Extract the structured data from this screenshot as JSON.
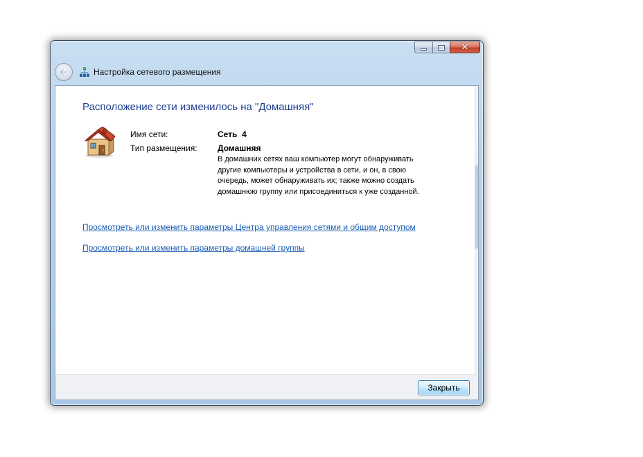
{
  "window": {
    "title": "Настройка сетевого размещения"
  },
  "caption": {
    "minimize_icon": "minimize-icon",
    "maximize_icon": "maximize-icon",
    "close_icon": "close-icon"
  },
  "main": {
    "heading": "Расположение сети изменилось на \"Домашняя\"",
    "network_name_label": "Имя сети:",
    "network_name_value": "Сеть  4",
    "location_type_label": "Тип размещения:",
    "location_type_value": "Домашняя",
    "description": "В домашних сетях ваш компьютер могут обнаруживать другие компьютеры и устройства в сети, и он, в свою очередь, может обнаруживать их; также можно создать домашнюю группу или присоединиться к уже созданной.",
    "link_network_center": "Просмотреть или изменить параметры Центра управления сетями и общим доступом",
    "link_homegroup": "Просмотреть или изменить параметры домашней группы"
  },
  "footer": {
    "close_label": "Закрыть"
  },
  "colors": {
    "heading": "#1e3d8f",
    "link": "#1a5cb5",
    "close_button": "#c1412b"
  }
}
